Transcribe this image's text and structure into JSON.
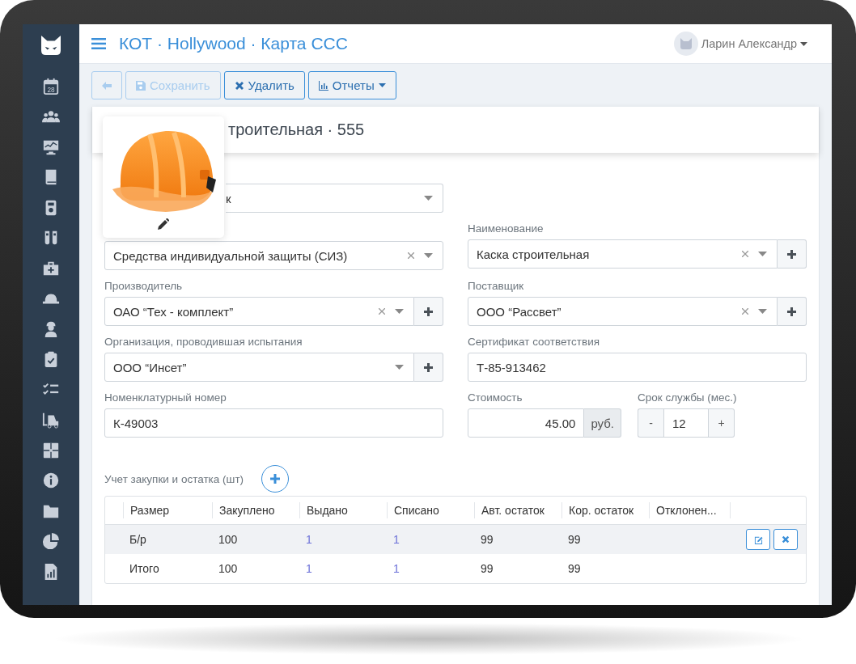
{
  "sidebar": {
    "items": [
      {
        "kind": "calendar",
        "day": "28"
      },
      {
        "kind": "users"
      },
      {
        "kind": "monitor"
      },
      {
        "kind": "book"
      },
      {
        "kind": "device"
      },
      {
        "kind": "flasks"
      },
      {
        "kind": "firstaid"
      },
      {
        "kind": "hardhat"
      },
      {
        "kind": "worker"
      },
      {
        "kind": "clipboard"
      },
      {
        "kind": "checklist"
      },
      {
        "kind": "forklift"
      },
      {
        "kind": "puzzle"
      },
      {
        "kind": "info"
      },
      {
        "kind": "folder"
      },
      {
        "kind": "pie"
      },
      {
        "kind": "filechart"
      }
    ]
  },
  "header": {
    "breadcrumb": "КОТ · Hollywood · Карта ССС",
    "user": "Ларин Александр"
  },
  "toolbar": [
    {
      "kind": "back",
      "disabled": true
    },
    {
      "kind": "save",
      "label": "Сохранить",
      "disabled": true
    },
    {
      "kind": "delete",
      "label": "Удалить",
      "disabled": false
    },
    {
      "kind": "reports",
      "label": "Отчеты",
      "disabled": false
    }
  ],
  "card": {
    "title": "троительная · 555"
  },
  "form": {
    "rows": [
      [
        [
          {
            "kind": "select",
            "value": "к",
            "clearable": false,
            "addable": false
          }
        ]
      ],
      [
        [
          {
            "kind": "select",
            "value": "Средства индивидуальной защиты (СИЗ)",
            "clearable": true,
            "addable": false
          }
        ],
        [
          {
            "kind": "select",
            "label": "Наименование",
            "value": "Каска строительная",
            "clearable": true,
            "addable": true
          }
        ]
      ],
      [
        [
          {
            "kind": "select",
            "label": "Производитель",
            "value": "ОАО “Тех - комплект”",
            "clearable": true,
            "addable": true
          }
        ],
        [
          {
            "kind": "select",
            "label": "Поставщик",
            "value": "ООО “Рассвет”",
            "clearable": true,
            "addable": true
          }
        ]
      ],
      [
        [
          {
            "kind": "select",
            "label": "Организация, проводившая испытания",
            "value": "ООО “Инсет”",
            "clearable": false,
            "addable": true
          }
        ],
        [
          {
            "kind": "text",
            "label": "Сертификат соответствия",
            "value": "Т-85-913462"
          }
        ]
      ],
      [
        [
          {
            "kind": "text",
            "label": "Номенклатурный номер",
            "value": "К-49003"
          }
        ],
        [
          {
            "kind": "price",
            "label": "Стоимость",
            "value": "45.00",
            "unit": "руб."
          },
          {
            "kind": "stepper",
            "label": "Срок службы (мес.)",
            "value": "12",
            "decrement": "-",
            "increment": "+"
          }
        ]
      ]
    ]
  },
  "purchases": {
    "label": "Учет закупки и остатка (шт)",
    "columns": [
      "Размер",
      "Закуплено",
      "Выдано",
      "Списано",
      "Авт. остаток",
      "Кор. остаток",
      "Отклонен..."
    ],
    "rows": [
      {
        "cells": [
          {
            "kind": "text",
            "text": "Б/р"
          },
          {
            "kind": "text",
            "text": "100"
          },
          {
            "kind": "link",
            "text": "1"
          },
          {
            "kind": "link",
            "text": "1"
          },
          {
            "kind": "text",
            "text": "99"
          },
          {
            "kind": "text",
            "text": "99"
          }
        ],
        "selected": true,
        "actions": true
      },
      {
        "cells": [
          {
            "kind": "text",
            "text": "Итого"
          },
          {
            "kind": "text",
            "text": "100"
          },
          {
            "kind": "link",
            "text": "1"
          },
          {
            "kind": "link",
            "text": "1"
          },
          {
            "kind": "text",
            "text": "99"
          },
          {
            "kind": "text",
            "text": "99"
          }
        ],
        "selected": false,
        "actions": false
      }
    ]
  }
}
